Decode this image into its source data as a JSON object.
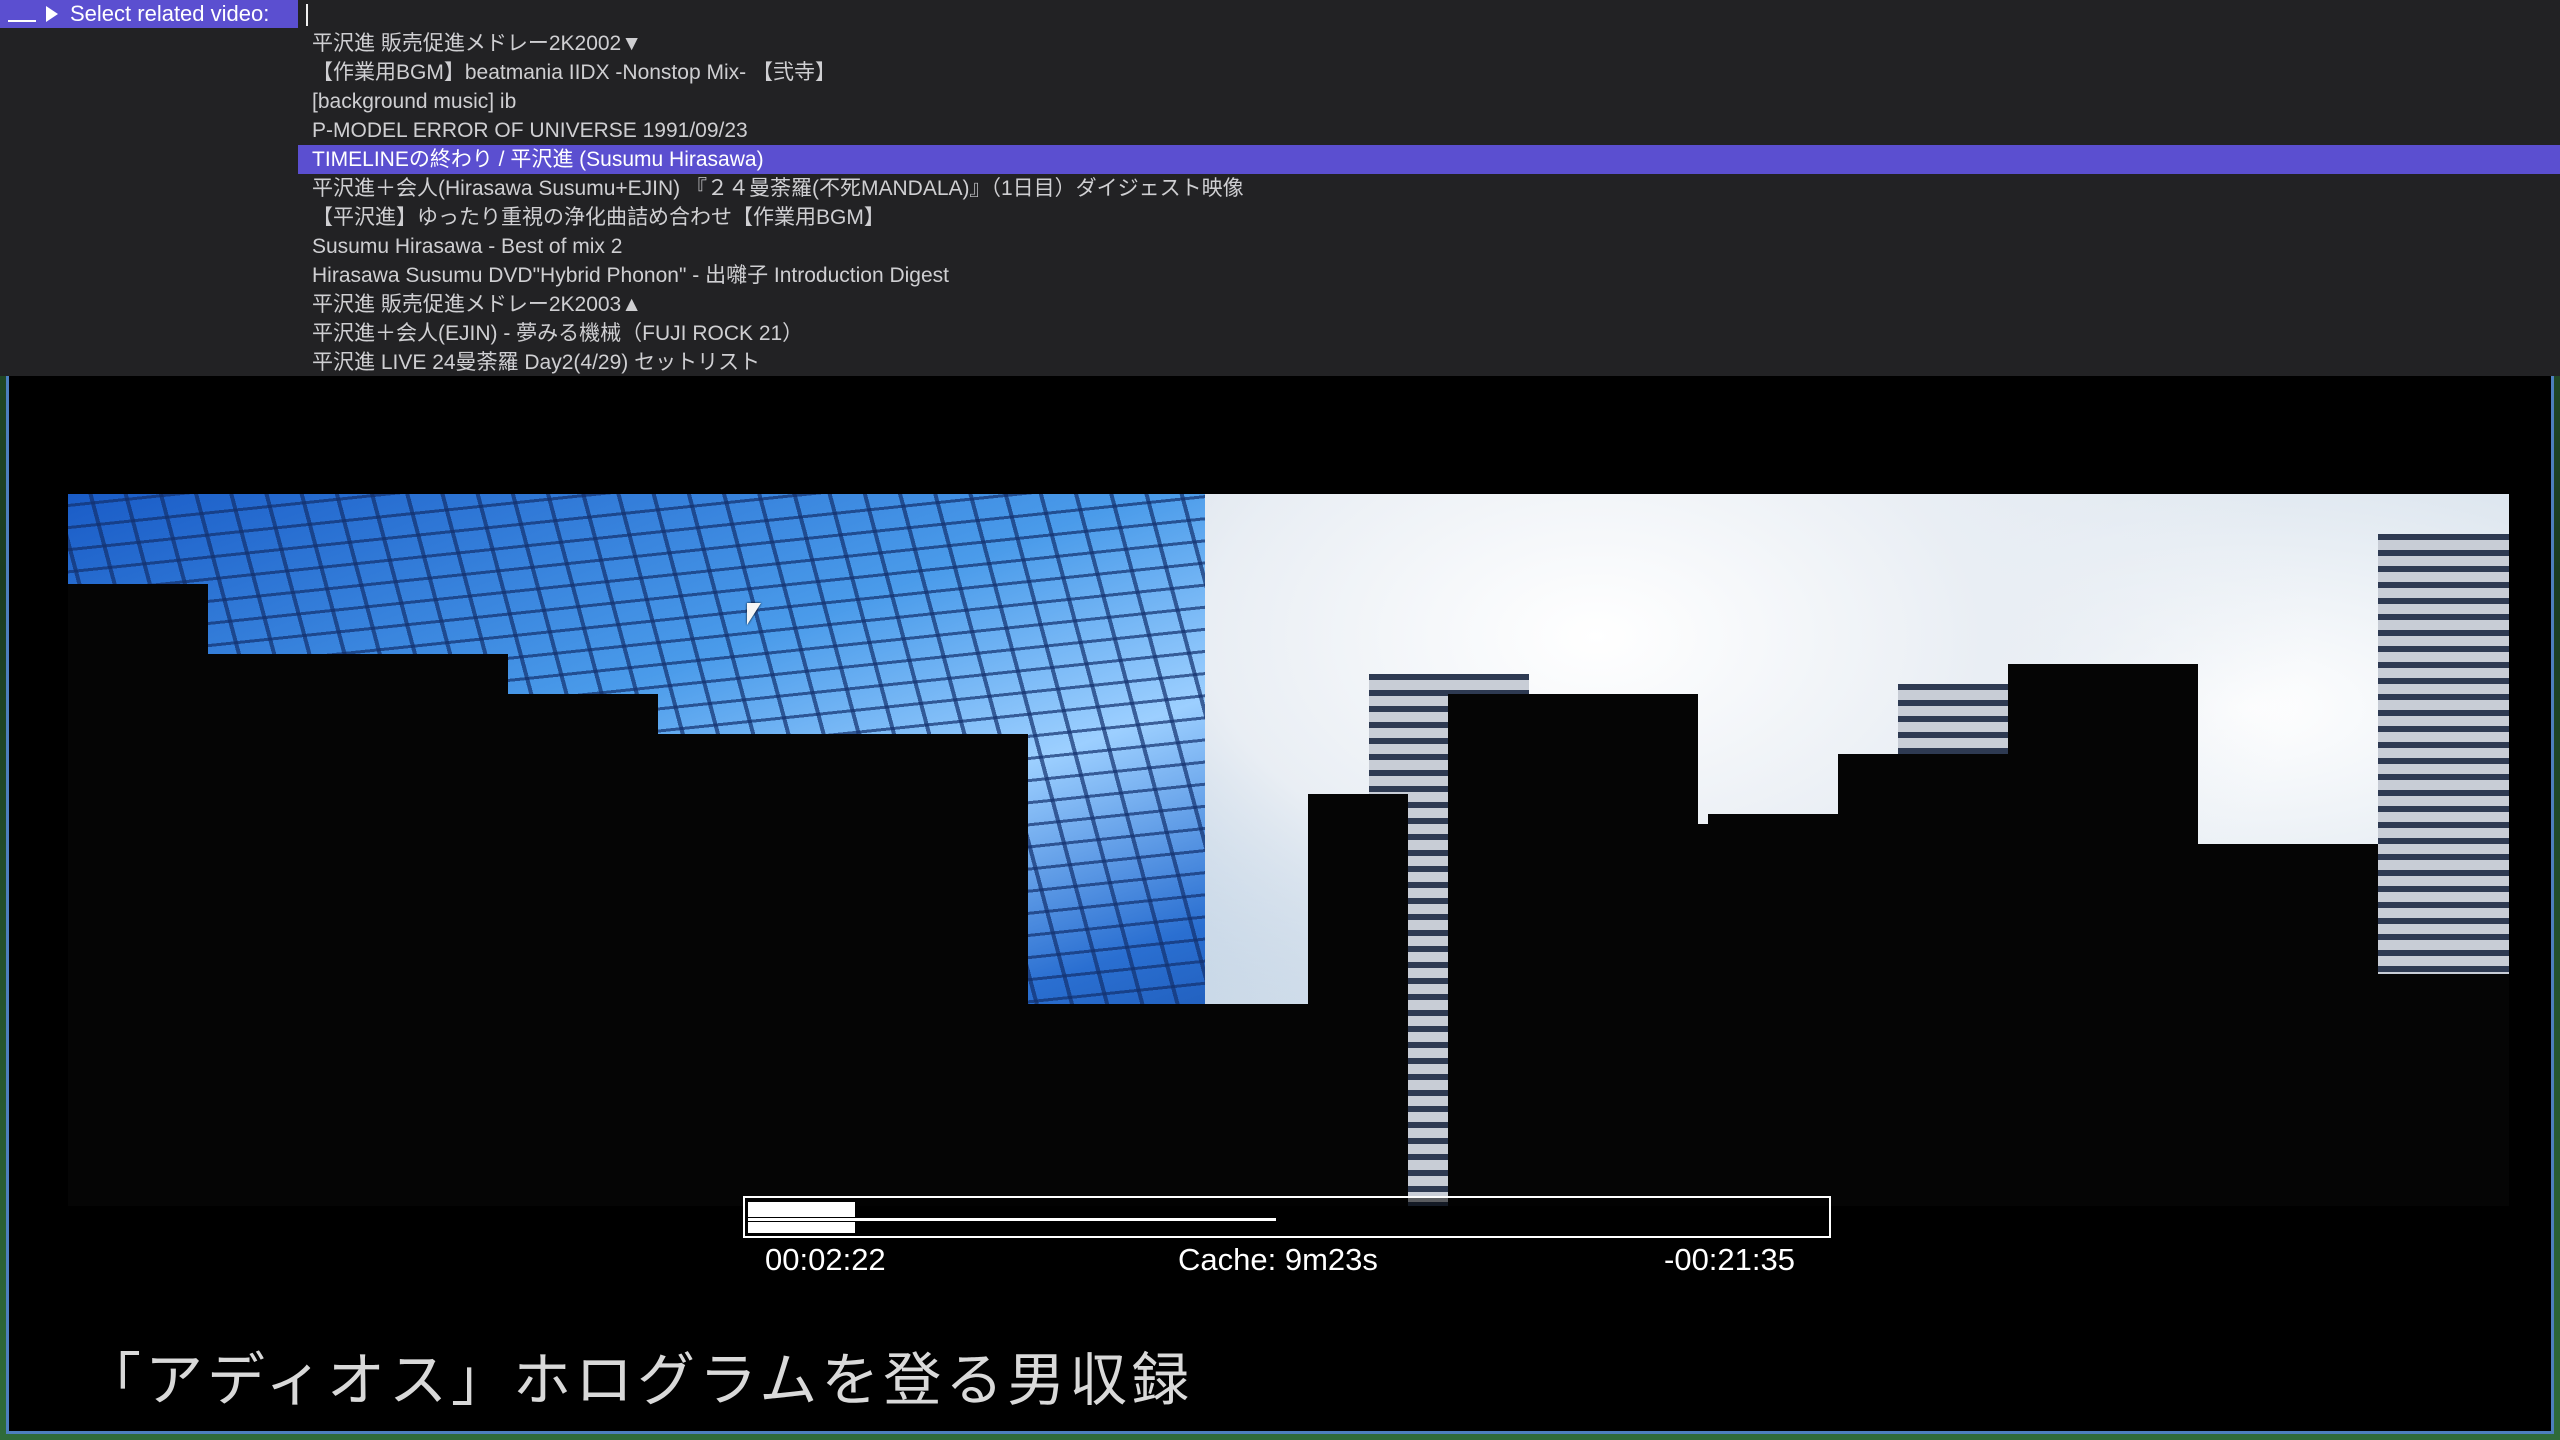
{
  "prompt": {
    "label": "Select related video:",
    "input_value": ""
  },
  "related_videos": [
    "平沢進 販売促進メドレー2K2002▼",
    "【作業用BGM】beatmania IIDX -Nonstop Mix- 【弐寺】",
    "[background music] ib",
    "P-MODEL ERROR OF UNIVERSE 1991/09/23",
    "TIMELINEの終わり / 平沢進 (Susumu Hirasawa)",
    "平沢進＋会人(Hirasawa Susumu+EJIN) 『２４曼荼羅(不死MANDALA)』（1日目）ダイジェスト映像",
    "【平沢進】ゆったり重視の浄化曲詰め合わせ【作業用BGM】",
    "Susumu Hirasawa - Best of mix 2",
    "Hirasawa Susumu DVD\"Hybrid Phonon\" - 出囃子 Introduction Digest",
    "平沢進 販売促進メドレー2K2003▲",
    "平沢進＋会人(EJIN) - 夢みる機械（FUJI ROCK 21）",
    "平沢進 LIVE 24曼荼羅 Day2(4/29) セットリスト"
  ],
  "selected_index": 4,
  "osc": {
    "elapsed": "00:02:22",
    "cache": "Cache: 9m23s",
    "remaining": "-00:21:35",
    "progress_fraction": 0.099,
    "cache_fraction": 0.49
  },
  "subtitle": "「アディオス」ホログラムを登る男収録",
  "colors": {
    "accent": "#5b4fd0",
    "overlay_bg": "#222224",
    "window_border": "#4d7fbe"
  }
}
